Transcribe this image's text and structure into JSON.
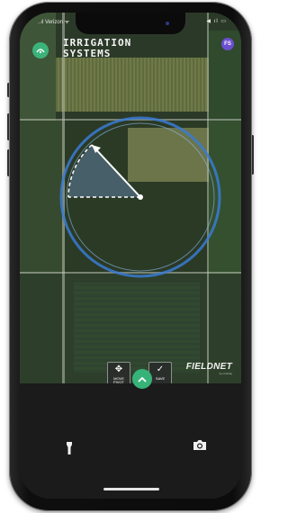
{
  "status_bar": {
    "carrier": "..ıl Verizon ᯤ",
    "right": "◀ ıl ▭"
  },
  "header": {
    "title_line1": "IRRIGATION",
    "title_line2": "SYSTEMS",
    "avatar_initials": "FS"
  },
  "controls": {
    "move_pivot": "MOVE PIVOT",
    "save": "SAVE"
  },
  "brand": {
    "name": "FIELDNET",
    "tagline": "by Lindsay"
  },
  "icons": [
    "logo-icon",
    "move-icon",
    "check-icon",
    "chevron-up-icon",
    "flashlight-icon",
    "camera-icon"
  ],
  "colors": {
    "accent_green": "#37b37a",
    "pivot_blue": "#3a7bd5",
    "avatar_purple": "#6c4fcf"
  }
}
